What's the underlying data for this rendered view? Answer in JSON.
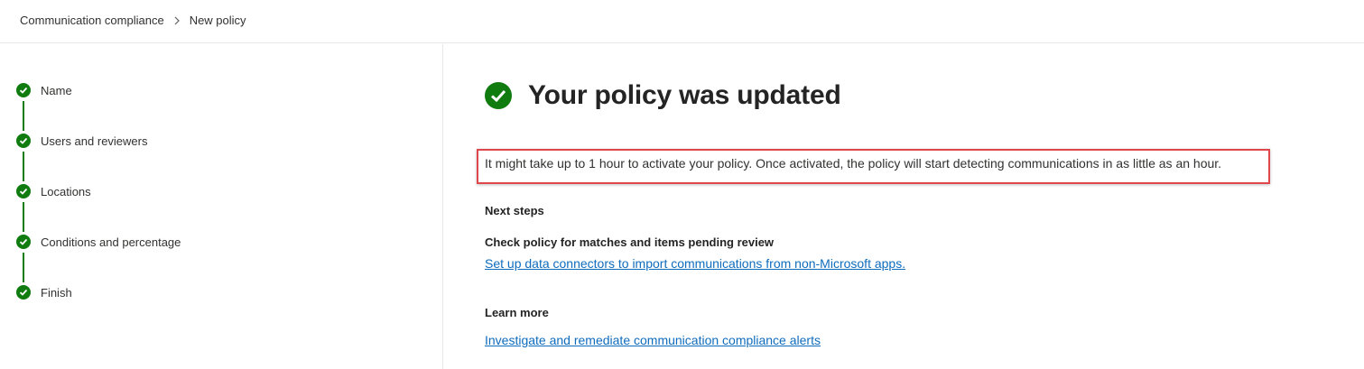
{
  "breadcrumb": {
    "parent": "Communication compliance",
    "current": "New policy"
  },
  "steps": [
    {
      "label": "Name",
      "status": "complete"
    },
    {
      "label": "Users and reviewers",
      "status": "complete"
    },
    {
      "label": "Locations",
      "status": "complete"
    },
    {
      "label": "Conditions and percentage",
      "status": "complete"
    },
    {
      "label": "Finish",
      "status": "complete"
    }
  ],
  "main": {
    "title": "Your policy was updated",
    "message": "It might take up to 1 hour to activate your policy. Once activated, the policy will start detecting communications in as little as an hour.",
    "next_steps": {
      "heading": "Next steps",
      "subheading": "Check policy for matches and items pending review",
      "link": "Set up data connectors to import communications from non-Microsoft apps."
    },
    "learn_more": {
      "heading": "Learn more",
      "link": "Investigate and remediate communication compliance alerts"
    }
  },
  "colors": {
    "success": "#107c10",
    "link": "#0f6cbd",
    "highlight": "#e0474c"
  },
  "icons": {
    "breadcrumb_separator": "chevron-right-icon",
    "step_status": "checkmark-circle-icon",
    "title_status": "checkmark-circle-icon"
  }
}
